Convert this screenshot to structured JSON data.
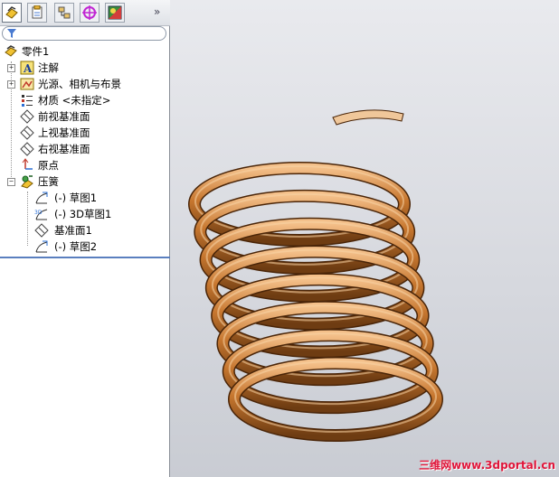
{
  "tabs": [
    {
      "icon": "feature-manager-icon",
      "active": true
    },
    {
      "icon": "property-manager-icon",
      "active": false
    },
    {
      "icon": "configuration-manager-icon",
      "active": false
    },
    {
      "icon": "dimxpert-icon",
      "active": false
    },
    {
      "icon": "display-manager-icon",
      "active": false
    }
  ],
  "more_symbol": "»",
  "filter": {
    "icon": "filter-icon"
  },
  "tree": {
    "root": "零件1",
    "items": [
      {
        "label": "注解",
        "icon": "annotations-icon",
        "expander": "+"
      },
      {
        "label": "光源、相机与布景",
        "icon": "lights-icon",
        "expander": "+"
      },
      {
        "label": "材质 <未指定>",
        "icon": "material-icon",
        "expander": ""
      },
      {
        "label": "前视基准面",
        "icon": "plane-icon",
        "expander": ""
      },
      {
        "label": "上视基准面",
        "icon": "plane-icon",
        "expander": ""
      },
      {
        "label": "右视基准面",
        "icon": "plane-icon",
        "expander": ""
      },
      {
        "label": "原点",
        "icon": "origin-icon",
        "expander": ""
      },
      {
        "label": "压簧",
        "icon": "spring-feature-icon",
        "expander": "−"
      }
    ],
    "children": [
      {
        "label": "(-) 草图1",
        "icon": "sketch-icon"
      },
      {
        "label": "(-) 3D草图1",
        "icon": "sketch3d-icon"
      },
      {
        "label": "基准面1",
        "icon": "plane-icon"
      },
      {
        "label": "(-) 草图2",
        "icon": "sketch-icon"
      }
    ]
  },
  "viewport": {
    "model": "compression-spring",
    "spring_color": "#c7772f",
    "watermark": "三维网www.3dportal.cn"
  }
}
